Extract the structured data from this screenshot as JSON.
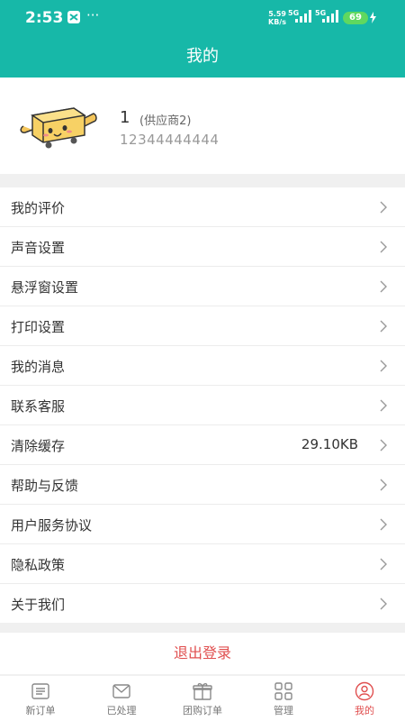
{
  "status_bar": {
    "time": "2:53",
    "dots": "···",
    "speed_value": "5.59",
    "speed_unit": "KB/s",
    "net1": "5G",
    "net2": "5G",
    "battery": "69"
  },
  "header": {
    "title": "我的"
  },
  "profile": {
    "name": "1",
    "role": "(供应商2)",
    "phone": "12344444444"
  },
  "menu": {
    "items": [
      {
        "label": "我的评价"
      },
      {
        "label": "声音设置"
      },
      {
        "label": "悬浮窗设置"
      },
      {
        "label": "打印设置"
      },
      {
        "label": "我的消息"
      },
      {
        "label": "联系客服"
      },
      {
        "label": "清除缓存",
        "value": "29.10KB"
      },
      {
        "label": "帮助与反馈"
      },
      {
        "label": "用户服务协议"
      },
      {
        "label": "隐私政策"
      },
      {
        "label": "关于我们"
      }
    ]
  },
  "logout_label": "退出登录",
  "tabbar": {
    "items": [
      {
        "label": "新订单",
        "icon": "list-icon"
      },
      {
        "label": "已处理",
        "icon": "mail-icon"
      },
      {
        "label": "团购订单",
        "icon": "gift-icon"
      },
      {
        "label": "管理",
        "icon": "grid-icon"
      },
      {
        "label": "我的",
        "icon": "user-icon"
      }
    ]
  },
  "colors": {
    "accent": "#17b8a8",
    "active": "#e04f4f"
  }
}
